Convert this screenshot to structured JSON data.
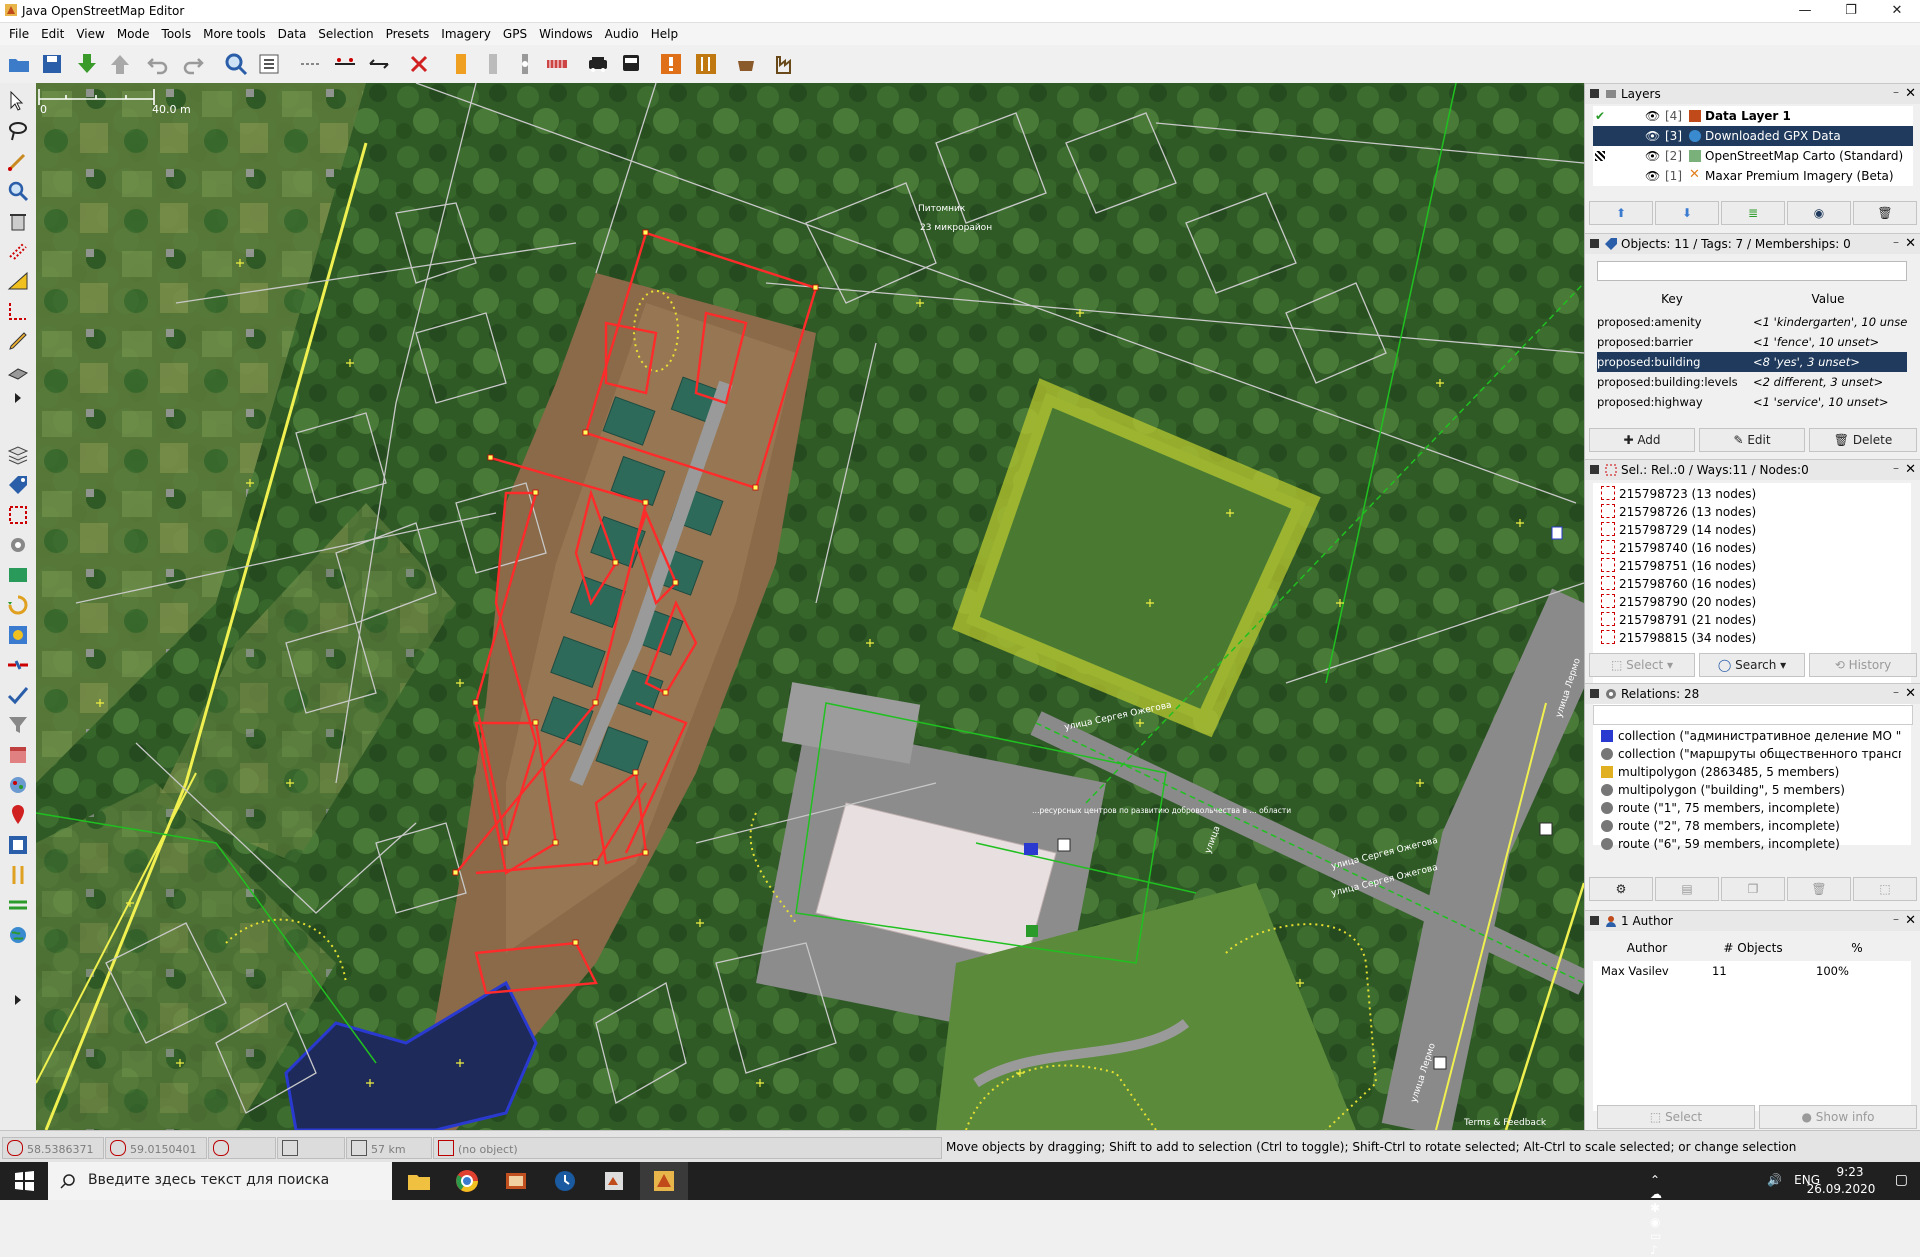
{
  "window": {
    "title": "Java OpenStreetMap Editor",
    "minimize": "—",
    "restore": "❐",
    "close": "✕"
  },
  "menu": [
    "File",
    "Edit",
    "View",
    "Mode",
    "Tools",
    "More tools",
    "Data",
    "Selection",
    "Presets",
    "Imagery",
    "GPS",
    "Windows",
    "Audio",
    "Help"
  ],
  "map": {
    "scale_zero": "0",
    "scale_value": "40.0 m",
    "labels": {
      "nursery_1": "Питомник",
      "nursery_2": "23 микрорайон",
      "street_1": "улица Сергея Ожегова",
      "street_2": "улица Сергея Ожегова",
      "street_3": "улица Сергея Ожегова",
      "street_4": "улица Лермо",
      "street_5": "улица Лермо",
      "street_6": "улица",
      "building_note": "…ресурсных центров по развитию добровольчества в … области",
      "attribution": "Terms & Feedback"
    }
  },
  "layers": {
    "title": "Layers",
    "items": [
      {
        "index": "[4]",
        "name": "Data Layer 1",
        "active": true
      },
      {
        "index": "[3]",
        "name": "Downloaded GPX Data",
        "selected": true
      },
      {
        "index": "[2]",
        "name": "OpenStreetMap Carto (Standard)"
      },
      {
        "index": "[1]",
        "name": "Maxar Premium Imagery (Beta)"
      }
    ]
  },
  "tags": {
    "title": "Objects: 11 / Tags: 7 / Memberships: 0",
    "col_key": "Key",
    "col_value": "Value",
    "rows": [
      {
        "key": "proposed:amenity",
        "value": "<1 'kindergarten', 10 unset>"
      },
      {
        "key": "proposed:barrier",
        "value": "<1 'fence', 10 unset>"
      },
      {
        "key": "proposed:building",
        "value": "<8 'yes', 3 unset>",
        "selected": true
      },
      {
        "key": "proposed:building:levels",
        "value": "<2 different, 3 unset>"
      },
      {
        "key": "proposed:highway",
        "value": "<1 'service', 10 unset>"
      }
    ],
    "add": "Add",
    "edit": "Edit",
    "delete": "Delete"
  },
  "selection": {
    "title": "Sel.: Rel.:0 / Ways:11 / Nodes:0",
    "items": [
      "215798723 (13 nodes)",
      "215798726 (13 nodes)",
      "215798729 (14 nodes)",
      "215798740 (16 nodes)",
      "215798751 (16 nodes)",
      "215798760 (16 nodes)",
      "215798790 (20 nodes)",
      "215798791 (21 nodes)",
      "215798815 (34 nodes)"
    ],
    "select": "Select",
    "search": "Search",
    "history": "History"
  },
  "relations": {
    "title": "Relations: 28",
    "items": [
      {
        "text": "collection (\"административное деление МО \"Город",
        "icon": "collection-icon"
      },
      {
        "text": "collection (\"маршруты общественного транспорта",
        "icon": "gear-icon"
      },
      {
        "text": "multipolygon (2863485, 5 members)",
        "icon": "multipolygon-icon"
      },
      {
        "text": "multipolygon (\"building\", 5 members)",
        "icon": "gear-icon"
      },
      {
        "text": "route (\"1\", 75 members, incomplete)",
        "icon": "gear-icon"
      },
      {
        "text": "route (\"2\", 78 members, incomplete)",
        "icon": "gear-icon"
      },
      {
        "text": "route (\"6\", 59 members, incomplete)",
        "icon": "gear-icon"
      }
    ]
  },
  "authors": {
    "title": "1 Author",
    "col_author": "Author",
    "col_objects": "# Objects",
    "col_pct": "%",
    "rows": [
      {
        "author": "Max Vasilev",
        "objects": "11",
        "pct": "100%"
      }
    ],
    "select": "Select",
    "show_info": "Show info"
  },
  "status": {
    "lat": "58.5386371",
    "lon": "59.0150401",
    "heading": "",
    "angle": "",
    "dist": "57 km",
    "objects": "(no object)",
    "message": "Move objects by dragging; Shift to add to selection (Ctrl to toggle); Shift-Ctrl to rotate selected; Alt-Ctrl to scale selected; or change selection"
  },
  "taskbar": {
    "search_placeholder": "Введите здесь текст для поиска",
    "lang": "ENG",
    "time": "9:23",
    "date": "26.09.2020"
  }
}
